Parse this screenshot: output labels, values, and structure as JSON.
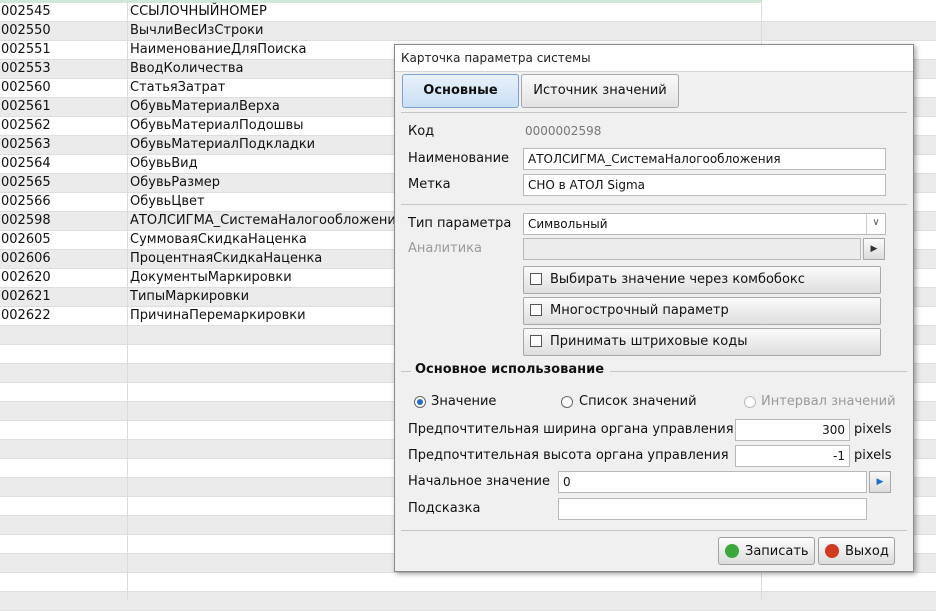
{
  "list": {
    "rows": [
      {
        "code": "002545",
        "name": "ССЫЛОЧНЫЙНОМЕР"
      },
      {
        "code": "002550",
        "name": "ВычлиВесИзСтроки"
      },
      {
        "code": "002551",
        "name": "НаименованиеДляПоиска"
      },
      {
        "code": "002553",
        "name": "ВводКоличества"
      },
      {
        "code": "002560",
        "name": "СтатьяЗатрат"
      },
      {
        "code": "002561",
        "name": "ОбувьМатериалВерха"
      },
      {
        "code": "002562",
        "name": "ОбувьМатериалПодошвы"
      },
      {
        "code": "002563",
        "name": "ОбувьМатериалПодкладки"
      },
      {
        "code": "002564",
        "name": "ОбувьВид"
      },
      {
        "code": "002565",
        "name": "ОбувьРазмер"
      },
      {
        "code": "002566",
        "name": "ОбувьЦвет"
      },
      {
        "code": "002598",
        "name": "АТОЛСИГМА_СистемаНалогообложения"
      },
      {
        "code": "002605",
        "name": "СуммоваяСкидкаНаценка"
      },
      {
        "code": "002606",
        "name": "ПроцентнаяСкидкаНаценка"
      },
      {
        "code": "002620",
        "name": "ДокументыМаркировки"
      },
      {
        "code": "002621",
        "name": "ТипыМаркировки"
      },
      {
        "code": "002622",
        "name": "ПричинаПеремаркировки"
      }
    ]
  },
  "dialog": {
    "title": "Карточка параметра системы",
    "tabs": [
      {
        "label": "Основные",
        "active": true
      },
      {
        "label": "Источник значений",
        "active": false
      }
    ],
    "code_label": "Код",
    "code_value": "0000002598",
    "name_label": "Наименование",
    "name_value": "АТОЛСИГМА_СистемаНалогообложения",
    "tag_label": "Метка",
    "tag_value": "СНО в АТОЛ Sigma",
    "type_label": "Тип параметра",
    "type_value": "Символьный",
    "analytics_label": "Аналитика",
    "analytics_value": "",
    "checkboxes": [
      {
        "label": "Выбирать значение через комбобокс",
        "checked": false
      },
      {
        "label": "Многострочный параметр",
        "checked": false
      },
      {
        "label": "Принимать штриховые коды",
        "checked": false
      }
    ],
    "section_title": "Основное использование",
    "radios": [
      {
        "label": "Значение",
        "selected": true
      },
      {
        "label": "Список значений",
        "selected": false
      },
      {
        "label": "Интервал значений",
        "selected": false,
        "disabled": true
      }
    ],
    "width_label": "Предпочтительная ширина органа управления",
    "width_value": "300",
    "height_label": "Предпочтительная высота органа управления",
    "height_value": "-1",
    "unit": "pixels",
    "initial_label": "Начальное значение",
    "initial_value": "0",
    "hint_label": "Подсказка",
    "hint_value": "",
    "save_label": "Записать",
    "exit_label": "Выход"
  },
  "colors": {
    "accent": "#1e6fd0",
    "save_icon": "#3aa83a",
    "exit_icon": "#d23a1e"
  }
}
